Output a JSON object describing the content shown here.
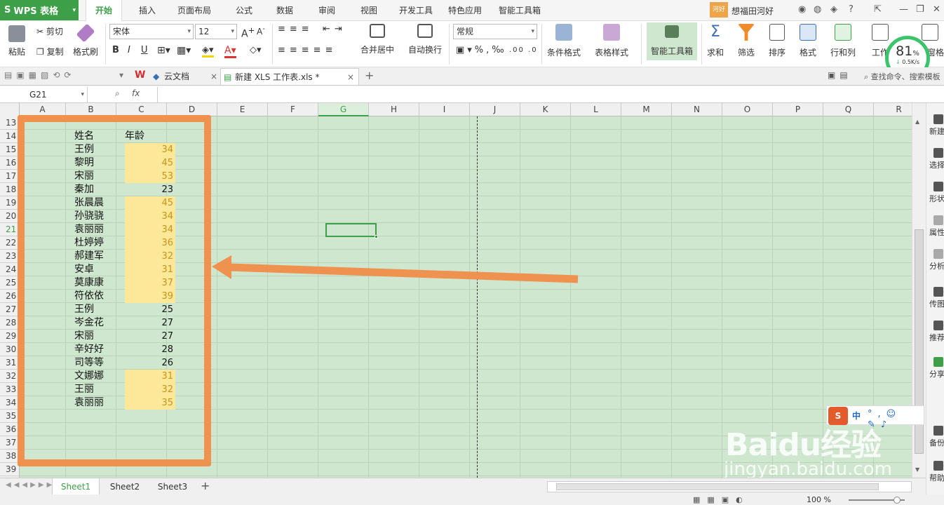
{
  "app": {
    "name": "WPS 表格"
  },
  "menu": {
    "tabs": [
      "开始",
      "插入",
      "页面布局",
      "公式",
      "数据",
      "审阅",
      "视图",
      "开发工具",
      "特色应用",
      "智能工具箱"
    ],
    "active": "开始"
  },
  "user": {
    "badge": "河好",
    "name": "想福田河好"
  },
  "ribbon": {
    "paste": "粘贴",
    "cut": "剪切",
    "copy": "复制",
    "format_painter": "格式刷",
    "font_name": "宋体",
    "font_size": "12",
    "merge_center": "合并居中",
    "auto_wrap": "自动换行",
    "number_format": "常规",
    "cond_format": "条件格式",
    "table_style": "表格样式",
    "smart_toolbox": "智能工具箱",
    "sum": "求和",
    "filter": "筛选",
    "sort": "排序",
    "format": "格式",
    "row_col": "行和列",
    "worksheet": "工作",
    "freeze": "冻结窗格"
  },
  "speed": {
    "percent": "81",
    "unit": "%",
    "rate": "0.5K/s"
  },
  "doc_tabs": [
    {
      "label": "云文档"
    },
    {
      "label": "新建 XLS 工作表.xls *",
      "active": true
    }
  ],
  "search": {
    "label": "查找命令、搜索模板"
  },
  "formula_bar": {
    "name_box": "G21",
    "fx": "fx",
    "formula": ""
  },
  "columns": [
    "A",
    "B",
    "C",
    "D",
    "E",
    "F",
    "G",
    "H",
    "I",
    "J",
    "K",
    "L",
    "M",
    "N",
    "O",
    "P",
    "Q",
    "R"
  ],
  "selected_column": "G",
  "rows": [
    "13",
    "14",
    "15",
    "16",
    "17",
    "18",
    "19",
    "20",
    "21",
    "22",
    "23",
    "24",
    "25",
    "26",
    "27",
    "28",
    "29",
    "30",
    "31",
    "32",
    "33",
    "34",
    "35",
    "36",
    "37",
    "38",
    "39"
  ],
  "selected_row": "21",
  "table": {
    "header": {
      "name": "姓名",
      "age": "年龄"
    },
    "records": [
      {
        "name": "王例",
        "age": "34",
        "highlight": true
      },
      {
        "name": "黎明",
        "age": "45",
        "highlight": true
      },
      {
        "name": "宋丽",
        "age": "53",
        "highlight": true
      },
      {
        "name": "秦加",
        "age": "23",
        "highlight": false
      },
      {
        "name": "张晨晨",
        "age": "45",
        "highlight": true
      },
      {
        "name": "孙骁骁",
        "age": "34",
        "highlight": true
      },
      {
        "name": "袁丽丽",
        "age": "34",
        "highlight": true
      },
      {
        "name": "杜婷婷",
        "age": "36",
        "highlight": true
      },
      {
        "name": "郝建军",
        "age": "32",
        "highlight": true
      },
      {
        "name": "安卓",
        "age": "31",
        "highlight": true
      },
      {
        "name": "莫康康",
        "age": "37",
        "highlight": true
      },
      {
        "name": "符依依",
        "age": "39",
        "highlight": true
      },
      {
        "name": "王例",
        "age": "25",
        "highlight": false
      },
      {
        "name": "岑金花",
        "age": "27",
        "highlight": false
      },
      {
        "name": "宋丽",
        "age": "27",
        "highlight": false
      },
      {
        "name": "辛好好",
        "age": "28",
        "highlight": false
      },
      {
        "name": "司等等",
        "age": "26",
        "highlight": false
      },
      {
        "name": "文娜娜",
        "age": "31",
        "highlight": true
      },
      {
        "name": "王丽",
        "age": "32",
        "highlight": true
      },
      {
        "name": "袁丽丽",
        "age": "35",
        "highlight": true
      }
    ]
  },
  "sidebar": [
    "新建",
    "选择",
    "形状",
    "属性",
    "分析",
    "传图",
    "推荐",
    "分享",
    "备份",
    "帮助"
  ],
  "sheets": [
    "Sheet1",
    "Sheet2",
    "Sheet3"
  ],
  "active_sheet": "Sheet1",
  "ime": {
    "label": "中"
  },
  "zoom": "100 %",
  "watermark": {
    "brand": "Baidu经验",
    "url": "jingyan.baidu.com"
  },
  "colors": {
    "accent": "#3d9f47",
    "grid_bg": "#cfe7cf",
    "highlight_fill": "#fde89a",
    "highlight_text": "#c8941a",
    "annotation": "#f0924f"
  }
}
